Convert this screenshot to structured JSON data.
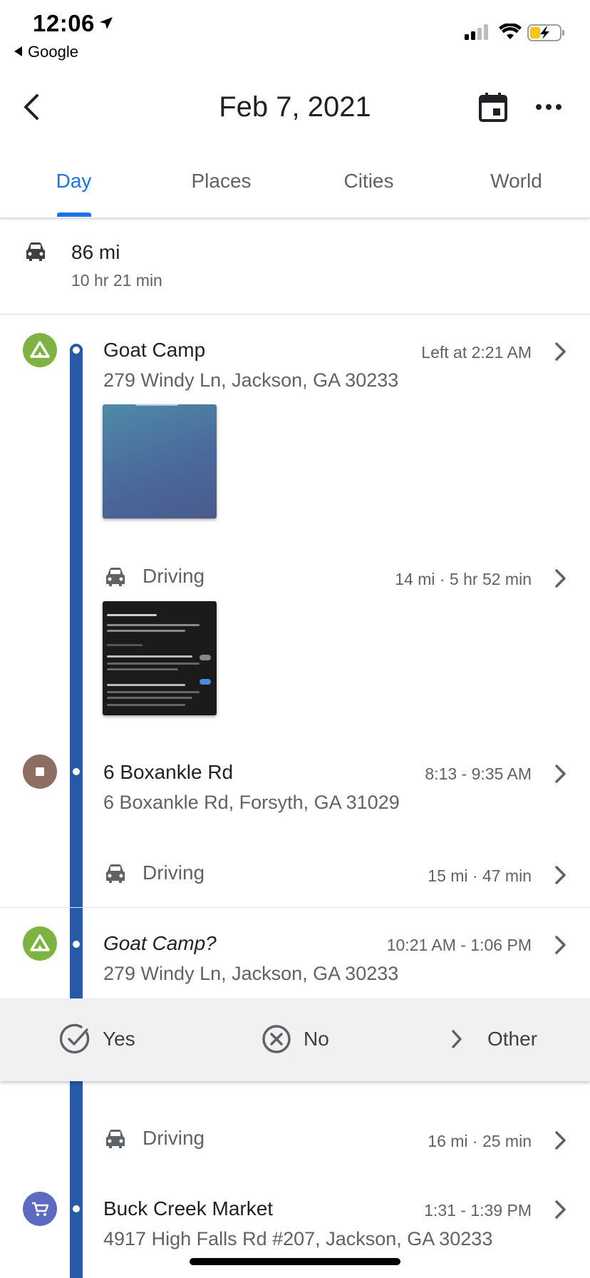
{
  "status_bar": {
    "time": "12:06",
    "back_app": "Google",
    "battery_color": "#f5c518"
  },
  "header": {
    "title": "Feb 7, 2021"
  },
  "tabs": [
    {
      "label": "Day",
      "active": true
    },
    {
      "label": "Places",
      "active": false
    },
    {
      "label": "Cities",
      "active": false
    },
    {
      "label": "World",
      "active": false
    }
  ],
  "summary": {
    "distance": "86 mi",
    "duration": "10 hr 21 min"
  },
  "timeline": [
    {
      "type": "place",
      "name": "Goat Camp",
      "address": "279 Windy Ln, Jackson, GA 30233",
      "time": "Left at 2:21 AM",
      "icon": "tent-icon",
      "color": "#7cb342"
    },
    {
      "type": "drive",
      "label": "Driving",
      "stats": "14 mi · 5 hr 52 min"
    },
    {
      "type": "place",
      "name": "6 Boxankle Rd",
      "address": "6 Boxankle Rd, Forsyth, GA 31029",
      "time": "8:13 - 9:35 AM",
      "icon": "stop-icon",
      "color": "#8d6e63"
    },
    {
      "type": "drive",
      "label": "Driving",
      "stats": "15 mi · 47 min"
    },
    {
      "type": "place",
      "name": "Goat Camp?",
      "address": "279 Windy Ln, Jackson, GA 30233",
      "time": "10:21 AM - 1:06 PM",
      "icon": "tent-icon",
      "color": "#7cb342"
    },
    {
      "type": "drive",
      "label": "Driving",
      "stats": "16 mi · 25 min"
    },
    {
      "type": "place",
      "name": "Buck Creek Market",
      "address": "4917 High Falls Rd #207, Jackson, GA 30233",
      "time": "1:31 - 1:39 PM",
      "icon": "cart-icon",
      "color": "#5c6bc0"
    }
  ],
  "confirm": {
    "yes": "Yes",
    "no": "No",
    "other": "Other"
  },
  "colors": {
    "accent": "#1a73e8",
    "timeline": "#245aa6"
  }
}
